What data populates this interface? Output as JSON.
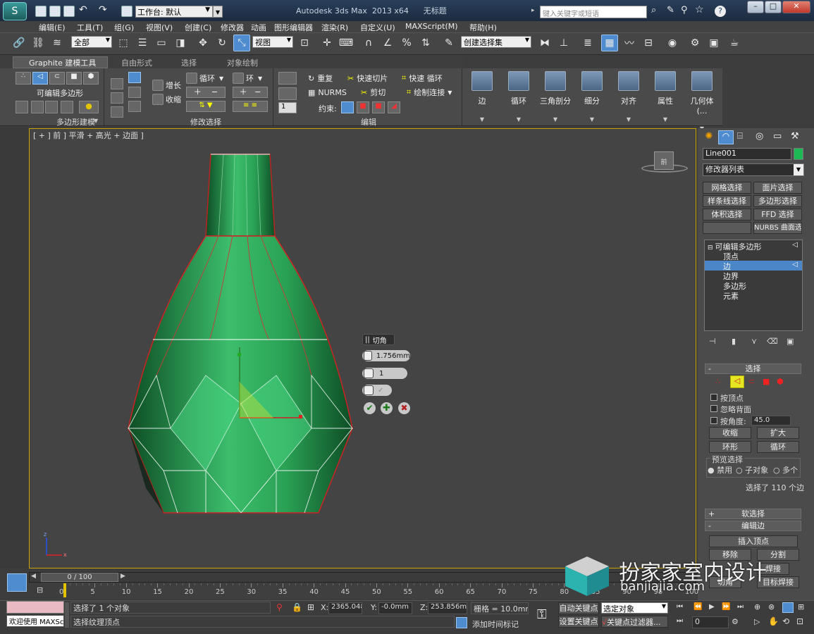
{
  "titlebar": {
    "title": "Autodesk 3ds Max  2013 x64      无标题",
    "workspace": "工作台: 默认",
    "search_placeholder": "键入关键字或短语"
  },
  "menubar": [
    "编辑(E)",
    "工具(T)",
    "组(G)",
    "视图(V)",
    "创建(C)",
    "修改器",
    "动画",
    "图形编辑器",
    "渲染(R)",
    "自定义(U)",
    "MAXScript(M)",
    "帮助(H)"
  ],
  "toolbar": {
    "selection_filter": "全部",
    "ref_coord": "视图",
    "named_selection": "创建选择集"
  },
  "ribbon": {
    "tabs": [
      "Graphite 建模工具",
      "自由形式",
      "选择",
      "对象绘制"
    ],
    "polygon_modeling": {
      "title": "多边形建模",
      "label": "可编辑多边形"
    },
    "modify_selection": {
      "title": "修改选择",
      "grow": "增长",
      "shrink": "收缩",
      "loop": "循环",
      "ring": "环"
    },
    "edit": {
      "title": "编辑",
      "repeat": "重复",
      "quickslice": "快速切片",
      "quickloop": "快速 循环",
      "nurms": "NURMS",
      "cut": "剪切",
      "paintconnect": "绘制连接",
      "constraint": "约束:",
      "spin_value": "1"
    },
    "big_buttons": [
      "边",
      "循环",
      "三角剖分",
      "细分",
      "对齐",
      "属性",
      "几何体 (..."
    ]
  },
  "viewport": {
    "label": "[ + ] 前 ] 平滑 + 高光 + 边面 ]",
    "viewcube_label": "前",
    "caddy": {
      "title": "切角",
      "amount": "1.756mm",
      "segments": "1"
    }
  },
  "command_panel": {
    "object_name": "Line001",
    "object_color": "#1db954",
    "modifier_list": "修改器列表",
    "mod_buttons": [
      "网格选择",
      "面片选择",
      "样条线选择",
      "多边形选择",
      "体积选择",
      "FFD 选择",
      "",
      "NURBS 曲面选择"
    ],
    "stack": [
      "可编辑多边形",
      "顶点",
      "边",
      "边界",
      "多边形",
      "元素"
    ],
    "selection": {
      "title": "选择",
      "by_vertex": "按顶点",
      "ignore_backfacing": "忽略背面",
      "by_angle": "按角度:",
      "angle_value": "45.0",
      "shrink": "收缩",
      "grow": "扩大",
      "ring": "环形",
      "loop": "循环",
      "preview_title": "预览选择",
      "preview_options": [
        "禁用",
        "子对象",
        "多个"
      ],
      "status": "选择了 110 个边"
    },
    "soft_selection": "软选择",
    "edit_edges": {
      "title": "编辑边",
      "insert_vertex": "插入顶点",
      "remove": "移除",
      "split": "分割",
      "weld": "焊接",
      "chamfer": "切角",
      "target_weld": "目标焊接"
    }
  },
  "timeline": {
    "frame": "0 / 100",
    "ticks": [
      "0",
      "5",
      "10",
      "15",
      "20",
      "25",
      "30",
      "35",
      "40",
      "45",
      "50",
      "55",
      "60",
      "65",
      "70",
      "75",
      "80",
      "85",
      "90",
      "95",
      "100"
    ]
  },
  "status": {
    "welcome": "欢迎使用 MAXSc",
    "selected": "选择了 1 个对象",
    "prompt": "选择纹理顶点",
    "x_label": "X:",
    "x_value": "2365.048m",
    "y_label": "Y:",
    "y_value": "-0.0mm",
    "z_label": "Z:",
    "z_value": "253.856mm",
    "grid": "栅格 = 10.0mm",
    "auto_key": "自动关键点",
    "set_key": "设置关键点",
    "selected_object": "选定对象",
    "key_filters": "关键点过滤器...",
    "add_time_tag": "添加时间标记",
    "frame_value": "0"
  },
  "watermark": {
    "title": "扮家家室内设计",
    "url": "banjiajia.com"
  }
}
